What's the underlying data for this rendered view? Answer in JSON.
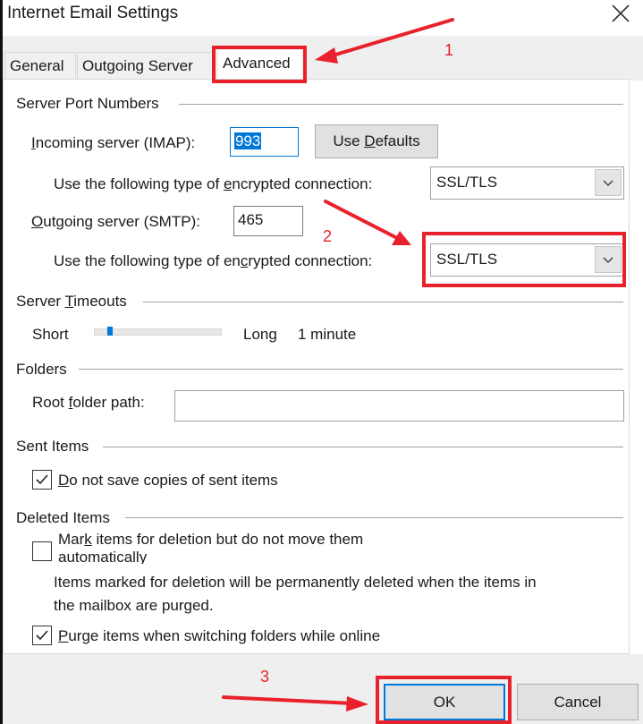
{
  "window": {
    "title": "Internet Email Settings",
    "close_icon": "close-x-icon"
  },
  "tabs": [
    {
      "label": "General",
      "active": false
    },
    {
      "label": "Outgoing Server",
      "active": false
    },
    {
      "label": "Advanced",
      "active": true
    }
  ],
  "server_ports": {
    "group_title": "Server Port Numbers",
    "incoming_label_pre": "",
    "incoming_label_u": "I",
    "incoming_label_post": "ncoming server (IMAP):",
    "incoming_value": "993",
    "use_defaults_pre": "Use ",
    "use_defaults_u": "D",
    "use_defaults_post": "efaults",
    "incoming_enc_pre": "Use the following type of ",
    "incoming_enc_u": "e",
    "incoming_enc_post": "ncrypted connection:",
    "incoming_enc_value": "SSL/TLS",
    "outgoing_label_u": "O",
    "outgoing_label_post": "utgoing server (SMTP):",
    "outgoing_value": "465",
    "outgoing_enc_pre": "Use the following type of en",
    "outgoing_enc_u": "c",
    "outgoing_enc_post": "rypted connection:",
    "outgoing_enc_value": "SSL/TLS"
  },
  "timeouts": {
    "group_title_pre": "Server ",
    "group_title_u": "T",
    "group_title_post": "imeouts",
    "short_label": "Short",
    "long_label": "Long",
    "value_text": "1 minute",
    "slider_fraction": 0.08
  },
  "folders": {
    "group_title": "Folders",
    "root_label_pre": "Root ",
    "root_label_u": "f",
    "root_label_post": "older path:",
    "root_value": ""
  },
  "sent_items": {
    "group_title": "Sent Items",
    "do_not_save_u": "D",
    "do_not_save_post": "o not save copies of sent items",
    "do_not_save_checked": true
  },
  "deleted_items": {
    "group_title": "Deleted Items",
    "mark_pre": "Mar",
    "mark_u": "k",
    "mark_post": " items for deletion but do not move them",
    "mark_line2": "automatically",
    "mark_checked": false,
    "info_line1": "Items marked for deletion will be permanently deleted when the items in",
    "info_line2": "the mailbox are purged.",
    "purge_u": "P",
    "purge_post": "urge items when switching folders while online",
    "purge_checked": true
  },
  "buttons": {
    "ok": "OK",
    "cancel": "Cancel"
  },
  "annotations": {
    "color": "#e8212c",
    "step1": "1",
    "step2": "2",
    "step3": "3"
  }
}
